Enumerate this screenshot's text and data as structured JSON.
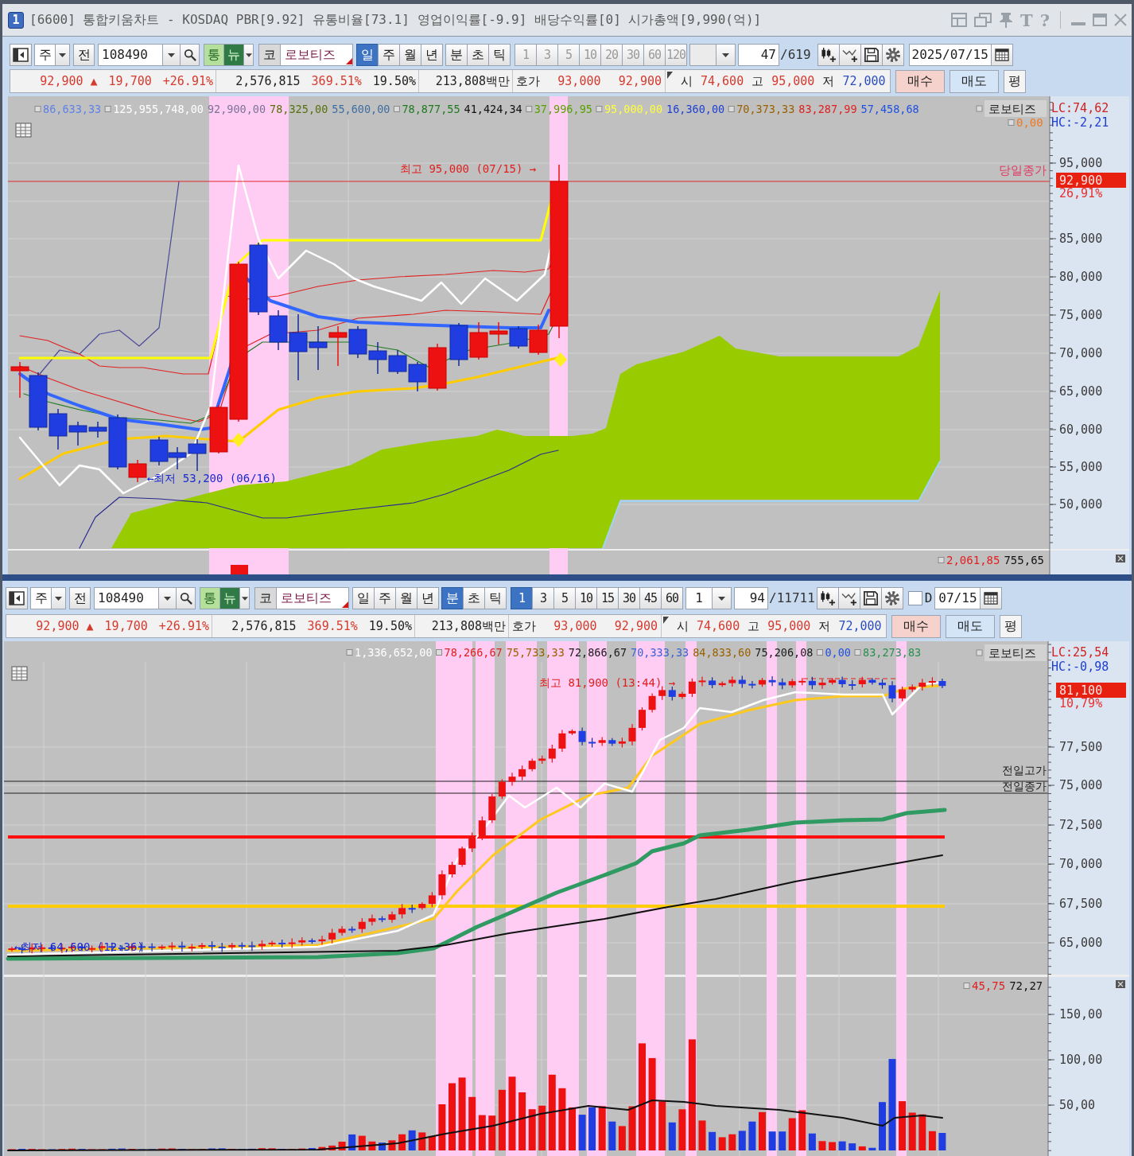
{
  "window": {
    "number": "1",
    "title": "[6600] 통합키움차트 - KOSDAQ PBR[9.92] 유통비율[73.1] 영업이익률[-9.9] 배당수익률[0] 시가총액[9,990(억)]",
    "tools": [
      {
        "kind": "layout"
      },
      {
        "kind": "windows"
      },
      {
        "kind": "pin"
      },
      {
        "kind": "text-tool",
        "label": "T"
      },
      {
        "kind": "help",
        "label": "?"
      },
      {
        "kind": "minimize"
      },
      {
        "kind": "maximize"
      },
      {
        "kind": "close"
      }
    ]
  },
  "panels": [
    {
      "toolbar": {
        "asset_type": "주",
        "prev_label": "전",
        "code": "108490",
        "toggles": [
          {
            "label": "통",
            "kind": "light"
          },
          {
            "label": "뉴",
            "kind": "dark"
          }
        ],
        "market": "코",
        "name": "로보티즈",
        "periods": [
          {
            "label": "일",
            "selected": true
          },
          {
            "label": "주",
            "selected": false
          },
          {
            "label": "월",
            "selected": false
          },
          {
            "label": "년",
            "selected": false
          },
          {
            "label": "분",
            "selected": false
          },
          {
            "label": "초",
            "selected": false
          },
          {
            "label": "틱",
            "selected": false
          }
        ],
        "intervals": [
          {
            "label": "1",
            "selected": false,
            "disabled": true
          },
          {
            "label": "3",
            "selected": false,
            "disabled": true
          },
          {
            "label": "5",
            "selected": false,
            "disabled": true
          },
          {
            "label": "10",
            "selected": false,
            "disabled": true
          },
          {
            "label": "20",
            "selected": false,
            "disabled": true
          },
          {
            "label": "30",
            "selected": false,
            "disabled": true
          },
          {
            "label": "60",
            "selected": false,
            "disabled": true
          },
          {
            "label": "120",
            "selected": false,
            "disabled": true
          }
        ],
        "unit": {
          "disabled": true
        },
        "count": "47",
        "total": "/619",
        "date": "2025/07/15"
      },
      "quote": {
        "groups": [
          [
            {
              "text": "92,900 ▲",
              "color": "#d63a2f"
            },
            {
              "text": "19,700",
              "color": "#d63a2f"
            },
            {
              "text": "+26.91%",
              "color": "#d63a2f"
            }
          ],
          [
            {
              "text": "2,576,815",
              "color": "#222222"
            },
            {
              "text": "369.51%",
              "color": "#d63a2f"
            },
            {
              "text": "19.50%",
              "color": "#222222"
            }
          ],
          [
            {
              "text": "213,808백만",
              "color": "#222222"
            }
          ],
          [
            {
              "text": "호가",
              "color": "#222222"
            },
            {
              "text": "93,000",
              "color": "#d63a2f"
            },
            {
              "text": "92,900",
              "color": "#d63a2f"
            }
          ],
          [
            {
              "text": "시",
              "color": "#222222"
            },
            {
              "text": "74,600",
              "color": "#d63a2f"
            },
            {
              "text": "고",
              "color": "#222222"
            },
            {
              "text": "95,000",
              "color": "#d63a2f"
            },
            {
              "text": "저",
              "color": "#222222"
            },
            {
              "text": "72,000",
              "color": "#2c4fc0"
            }
          ]
        ],
        "buttons": [
          {
            "label": "매수",
            "kind": "buy"
          },
          {
            "label": "매도",
            "kind": "sell"
          },
          {
            "label": "평",
            "kind": "plain"
          }
        ]
      },
      "chart": {
        "kind": "daily",
        "legend": [
          {
            "text": "86,633,33",
            "color": "#5f82e6",
            "marker": true
          },
          {
            "text": "125,955,748,00",
            "color": "#ffffff",
            "marker": true
          },
          {
            "text": "92,900,00",
            "color": "#7c7498",
            "marker": false
          },
          {
            "text": "78,325,00",
            "color": "#56700c",
            "marker": false
          },
          {
            "text": "55,600,00",
            "color": "#3f6ea0",
            "marker": false
          },
          {
            "text": "78,877,55",
            "color": "#1f7a1f",
            "marker": true
          },
          {
            "text": "41,424,34",
            "color": "#111111",
            "marker": false
          },
          {
            "text": "37,996,95",
            "color": "#5aa000",
            "marker": true
          },
          {
            "text": "95,000,00",
            "color": "#ffff3c",
            "marker": true
          },
          {
            "text": "16,360,00",
            "color": "#2040d0",
            "marker": false
          },
          {
            "text": "70,373,33",
            "color": "#9a6000",
            "marker": true
          },
          {
            "text": "83,287,99",
            "color": "#e02020",
            "marker": false
          },
          {
            "text": "57,458,68",
            "color": "#2050e0",
            "marker": false
          }
        ],
        "name_tag": {
          "text": "로보티즈",
          "marker": true
        },
        "legend_extra": [
          {
            "text": "0,00",
            "color": "#f07820",
            "marker": true
          }
        ],
        "lc": "LC:74,62",
        "hc": "HC:-2,21",
        "axis": [
          "95,000",
          "85,000",
          "80,000",
          "75,000",
          "70,000",
          "65,000",
          "60,000",
          "55,000",
          "50,000"
        ],
        "price_tag": "92,900",
        "change_tag": "26,91%",
        "high_label": "최고 95,000 (07/15) →",
        "low_label": "←최저 53,200 (06/16)",
        "line_labels": [
          "당일종가"
        ],
        "sub_pane": {
          "legend": [
            {
              "text": "2,061,85",
              "color": "#e02020",
              "marker": true
            },
            {
              "text": "755,65",
              "color": "#111111",
              "marker": false
            }
          ]
        }
      }
    },
    {
      "toolbar": {
        "asset_type": "주",
        "prev_label": "전",
        "code": "108490",
        "toggles": [
          {
            "label": "통",
            "kind": "light"
          },
          {
            "label": "뉴",
            "kind": "dark"
          }
        ],
        "market": "코",
        "name": "로보티즈",
        "periods": [
          {
            "label": "일",
            "selected": false
          },
          {
            "label": "주",
            "selected": false
          },
          {
            "label": "월",
            "selected": false
          },
          {
            "label": "년",
            "selected": false
          },
          {
            "label": "분",
            "selected": true
          },
          {
            "label": "초",
            "selected": false
          },
          {
            "label": "틱",
            "selected": false
          }
        ],
        "intervals": [
          {
            "label": "1",
            "selected": true,
            "disabled": false
          },
          {
            "label": "3",
            "selected": false,
            "disabled": false
          },
          {
            "label": "5",
            "selected": false,
            "disabled": false
          },
          {
            "label": "10",
            "selected": false,
            "disabled": false
          },
          {
            "label": "15",
            "selected": false,
            "disabled": false
          },
          {
            "label": "30",
            "selected": false,
            "disabled": false
          },
          {
            "label": "45",
            "selected": false,
            "disabled": false
          },
          {
            "label": "60",
            "selected": false,
            "disabled": false
          }
        ],
        "unit": {
          "value": "1",
          "disabled": false
        },
        "count": "94",
        "total": "/11711",
        "check": {
          "label": "D",
          "checked": false
        },
        "date": "07/15"
      },
      "quote": {
        "groups": [
          [
            {
              "text": "92,900 ▲",
              "color": "#d63a2f"
            },
            {
              "text": "19,700",
              "color": "#d63a2f"
            },
            {
              "text": "+26.91%",
              "color": "#d63a2f"
            }
          ],
          [
            {
              "text": "2,576,815",
              "color": "#222222"
            },
            {
              "text": "369.51%",
              "color": "#d63a2f"
            },
            {
              "text": "19.50%",
              "color": "#222222"
            }
          ],
          [
            {
              "text": "213,808백만",
              "color": "#222222"
            }
          ],
          [
            {
              "text": "호가",
              "color": "#222222"
            },
            {
              "text": "93,000",
              "color": "#d63a2f"
            },
            {
              "text": "92,900",
              "color": "#d63a2f"
            }
          ],
          [
            {
              "text": "시",
              "color": "#222222"
            },
            {
              "text": "74,600",
              "color": "#d63a2f"
            },
            {
              "text": "고",
              "color": "#222222"
            },
            {
              "text": "95,000",
              "color": "#d63a2f"
            },
            {
              "text": "저",
              "color": "#222222"
            },
            {
              "text": "72,000",
              "color": "#2c4fc0"
            }
          ]
        ],
        "buttons": [
          {
            "label": "매수",
            "kind": "buy"
          },
          {
            "label": "매도",
            "kind": "sell"
          },
          {
            "label": "평",
            "kind": "plain"
          }
        ]
      },
      "chart": {
        "kind": "intraday",
        "legend": [
          {
            "text": "1,336,652,00",
            "color": "#ffffff",
            "marker": true
          },
          {
            "text": "78,266,67",
            "color": "#e02020",
            "marker": true
          },
          {
            "text": "75,733,33",
            "color": "#9a6000",
            "marker": false
          },
          {
            "text": "72,866,67",
            "color": "#1a1a1a",
            "marker": false
          },
          {
            "text": "70,333,33",
            "color": "#3a62d8",
            "marker": false
          },
          {
            "text": "84,833,60",
            "color": "#9a6000",
            "marker": false
          },
          {
            "text": "75,206,08",
            "color": "#1a1a1a",
            "marker": false
          },
          {
            "text": "0,00",
            "color": "#2050e0",
            "marker": true
          },
          {
            "text": "83,273,83",
            "color": "#2a9050",
            "marker": true
          }
        ],
        "name_tag": {
          "text": "로보티즈",
          "marker": true
        },
        "lc": "LC:25,54",
        "hc": "HC:-0,98",
        "axis": [
          "77,500",
          "75,000",
          "72,500",
          "70,000",
          "67,500",
          "65,000"
        ],
        "price_tag": "81,100",
        "change_tag": "10,79%",
        "high_label": "최고 81,900 (13:44) →",
        "low_label": "←최저 64,600 (12:36)",
        "line_labels": [
          "전일고가",
          "전일종가"
        ],
        "volume_pane": {
          "legend": [
            {
              "text": "45,75",
              "color": "#e02020",
              "marker": true
            },
            {
              "text": "72,27",
              "color": "#111111",
              "marker": false
            }
          ],
          "axis": [
            "150,00",
            "100,00",
            "50,00"
          ]
        }
      }
    }
  ]
}
